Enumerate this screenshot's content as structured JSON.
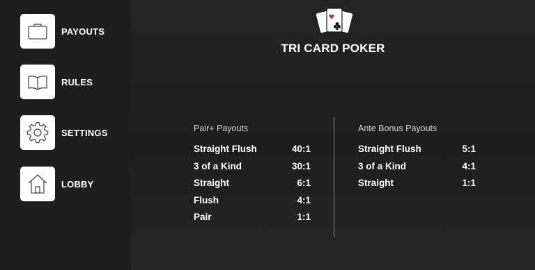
{
  "sidebar": {
    "items": [
      {
        "label": "PAYOUTS",
        "icon": "briefcase-icon"
      },
      {
        "label": "RULES",
        "icon": "book-icon"
      },
      {
        "label": "SETTINGS",
        "icon": "gear-icon"
      },
      {
        "label": "LOBBY",
        "icon": "home-icon"
      }
    ]
  },
  "header": {
    "title": "TRI CARD POKER",
    "logo_icon": "playing-cards-icon"
  },
  "payouts": {
    "pair_plus": {
      "title": "Pair+ Payouts",
      "rows": [
        {
          "hand": "Straight Flush",
          "payout": "40:1"
        },
        {
          "hand": "3 of a Kind",
          "payout": "30:1"
        },
        {
          "hand": "Straight",
          "payout": "6:1"
        },
        {
          "hand": "Flush",
          "payout": "4:1"
        },
        {
          "hand": "Pair",
          "payout": "1:1"
        }
      ]
    },
    "ante_bonus": {
      "title": "Ante Bonus Payouts",
      "rows": [
        {
          "hand": "Straight Flush",
          "payout": "5:1"
        },
        {
          "hand": "3 of a Kind",
          "payout": "4:1"
        },
        {
          "hand": "Straight",
          "payout": "1:1"
        }
      ]
    }
  },
  "colors": {
    "background": "#1b1b1b",
    "icon_box": "#ffffff",
    "table_title": "#d6d9c6",
    "divider": "#8a8a8a"
  }
}
